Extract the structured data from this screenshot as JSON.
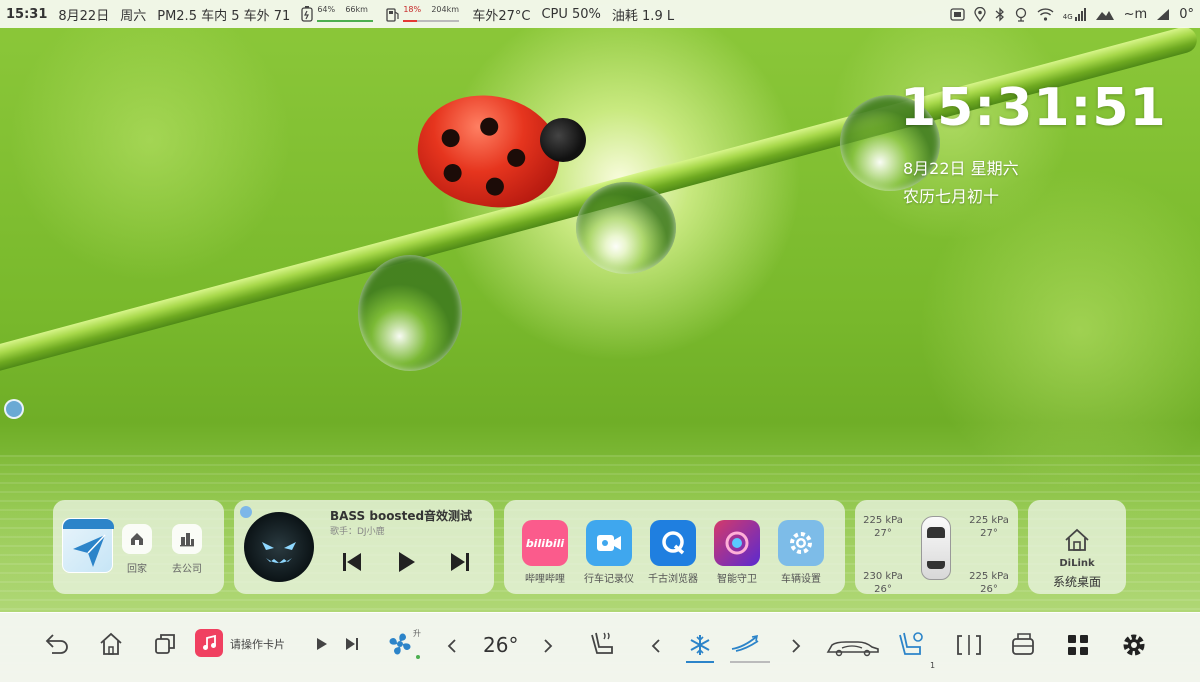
{
  "status_bar": {
    "time": "15:31",
    "date": "8月22日",
    "weekday": "周六",
    "pm25": "PM2.5 车内 5 车外 71",
    "battery_pct": "64%",
    "battery_range": "66km",
    "fuel_pct": "18%",
    "fuel_range": "204km",
    "outside_temp": "车外27°C",
    "cpu": "CPU 50%",
    "fuel_consumption": "油耗 1.9 L",
    "signal_label": "4G",
    "right_text": "~m",
    "right_temp": "0°"
  },
  "clock": {
    "time": "15:31:51",
    "date": "8月22日  星期六",
    "lunar": "农历七月初十"
  },
  "nav_card": {
    "home_label": "回家",
    "work_label": "去公司"
  },
  "music_card": {
    "title": "BASS boosted音效测试",
    "artist": "歌手：DJ小鹿"
  },
  "apps_card": {
    "apps": [
      {
        "label": "哔哩哔哩",
        "color": "#fb5b8c",
        "icon": "bilibili-icon",
        "text": "bilibili"
      },
      {
        "label": "行车记录仪",
        "color": "#3fa7ee",
        "icon": "dashcam-icon"
      },
      {
        "label": "千古浏览器",
        "color": "#1f7fe0",
        "icon": "browser-icon"
      },
      {
        "label": "智能守卫",
        "color": "#7c3fd6",
        "icon": "guard-icon"
      },
      {
        "label": "车辆设置",
        "color": "#6fb6e6",
        "icon": "gear-icon"
      }
    ]
  },
  "tire_card": {
    "front_left": {
      "pressure": "225 kPa",
      "temp": "27°"
    },
    "front_right": {
      "pressure": "225 kPa",
      "temp": "27°"
    },
    "rear_left": {
      "pressure": "230 kPa",
      "temp": "26°"
    },
    "rear_right": {
      "pressure": "225 kPa",
      "temp": "26°"
    }
  },
  "dilink_card": {
    "brand": "DiLink",
    "label": "系统桌面"
  },
  "dock": {
    "card_label": "请操作卡片",
    "fan_label": "升",
    "temperature": "26°",
    "seat_label": "1"
  },
  "colors": {
    "accent_blue": "#2c84c9",
    "music_red": "#f04060",
    "battery_green": "#4caf50",
    "fuel_red": "#e53935"
  }
}
